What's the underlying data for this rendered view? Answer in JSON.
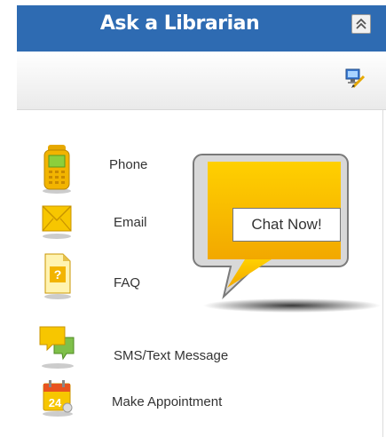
{
  "header": {
    "title": "Ask a Librarian"
  },
  "contact_options": [
    {
      "label": "Phone",
      "icon": "phone-icon"
    },
    {
      "label": "Email",
      "icon": "envelope-icon"
    },
    {
      "label": "FAQ",
      "icon": "faq-document-icon"
    },
    {
      "label": "SMS/Text Message",
      "icon": "chat-bubbles-icon"
    },
    {
      "label": "Make Appointment",
      "icon": "calendar-icon"
    }
  ],
  "chat": {
    "button_label": "Chat Now!"
  },
  "calendar_icon_day": "24",
  "faq_icon_mark": "?",
  "colors": {
    "header_bg": "#2e6bb2",
    "accent_yellow": "#f7c600",
    "bubble_gray": "#cfcfcf"
  }
}
